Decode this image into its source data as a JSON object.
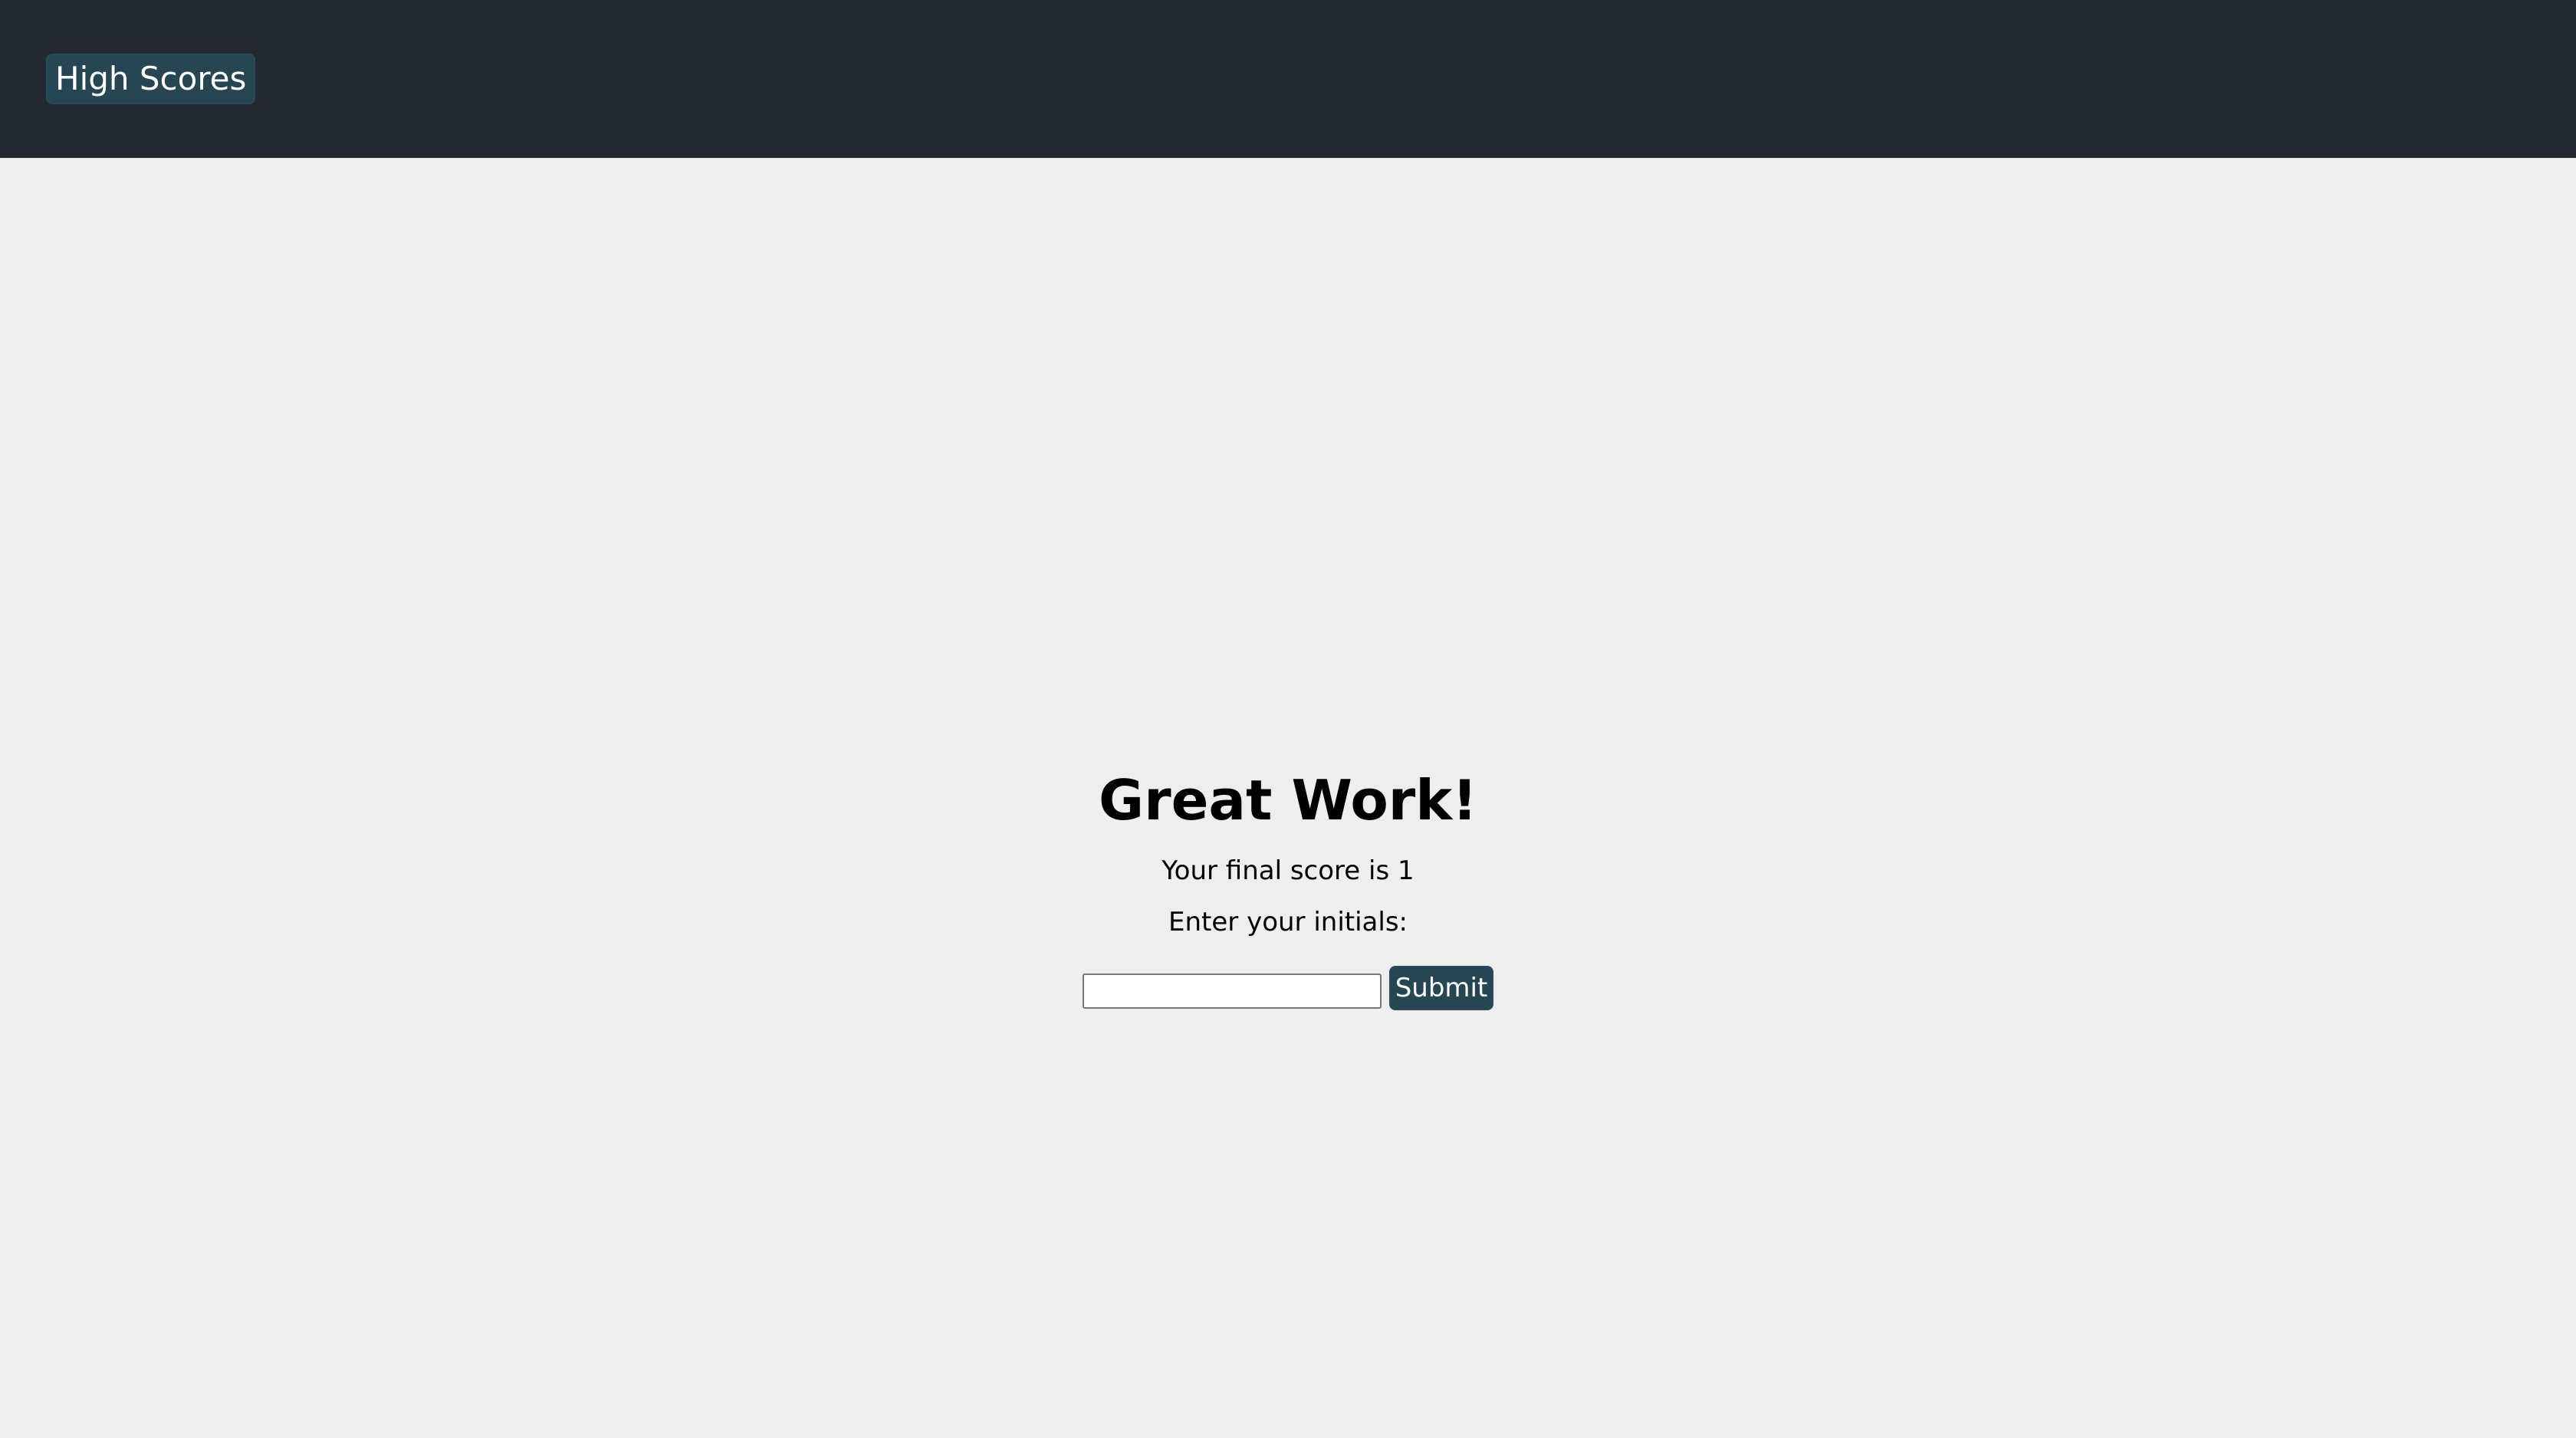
{
  "header": {
    "high_scores_label": "High Scores"
  },
  "results": {
    "title": "Great Work!",
    "score_text": "Your final score is 1",
    "initials_prompt": "Enter your initials:",
    "initials_value": "",
    "initials_placeholder": "",
    "submit_label": "Submit"
  },
  "colors": {
    "topbar_background": "#232831",
    "page_background": "#eeeeee",
    "button_background": "#264653",
    "button_text": "#ffffff"
  }
}
